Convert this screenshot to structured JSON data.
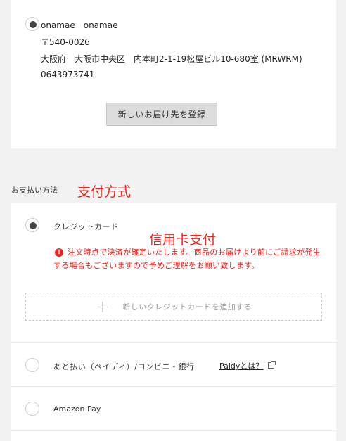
{
  "address": {
    "name": "onamae　onamae",
    "postal": "〒540-0026",
    "street": "大阪府　大阪市中央区　内本町2-1-19松屋ビル10-680室 (MRWRM)",
    "phone": "0643973741",
    "new_address_button": "新しいお届け先を登録"
  },
  "payment_section": {
    "label": "お支払い方法",
    "annotation": "支付方式"
  },
  "credit_card": {
    "label": "クレジットカード",
    "annotation": "信用卡支付",
    "notice": "注文時点で決済が確定いたします。商品のお届けより前にご請求が発生する場合もございますので予めご理解をお願い致します。",
    "add_card_label": "新しいクレジットカードを追加する"
  },
  "deferred": {
    "label": "あと払い（ペイディ）/コンビニ・銀行",
    "link": "Paidyとは？"
  },
  "amazon_pay": {
    "label": "Amazon Pay"
  },
  "colors": {
    "accent_red": "#e8231b",
    "background": "#f2f2f2"
  }
}
